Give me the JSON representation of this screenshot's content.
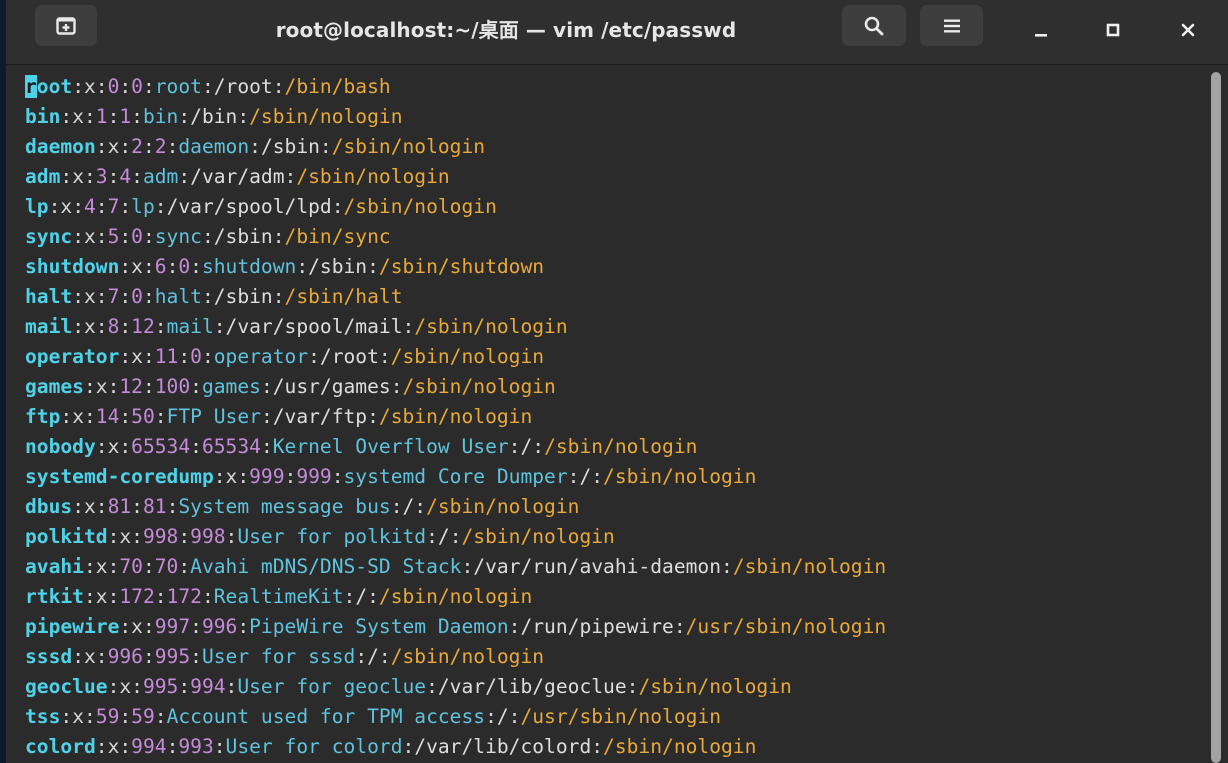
{
  "window": {
    "title": "root@localhost:~/桌面 — vim /etc/passwd",
    "buttons": {
      "new_tab_icon": "new-tab-icon",
      "search_icon": "search-icon",
      "menu_icon": "hamburger-menu-icon",
      "minimize_icon": "minimize-icon",
      "maximize_icon": "maximize-icon",
      "close_icon": "close-icon"
    }
  },
  "colors": {
    "username": "#4fd2e8",
    "ids": "#c58bd9",
    "gecos": "#5fc3de",
    "home": "#dddddd",
    "shell": "#e8a93a",
    "background": "#2b2b2b"
  },
  "terminal": {
    "lines": [
      {
        "user": "root",
        "pw": "x",
        "uid": "0",
        "gid": "0",
        "gecos": "root",
        "home": "/root",
        "shell": "/bin/bash"
      },
      {
        "user": "bin",
        "pw": "x",
        "uid": "1",
        "gid": "1",
        "gecos": "bin",
        "home": "/bin",
        "shell": "/sbin/nologin"
      },
      {
        "user": "daemon",
        "pw": "x",
        "uid": "2",
        "gid": "2",
        "gecos": "daemon",
        "home": "/sbin",
        "shell": "/sbin/nologin"
      },
      {
        "user": "adm",
        "pw": "x",
        "uid": "3",
        "gid": "4",
        "gecos": "adm",
        "home": "/var/adm",
        "shell": "/sbin/nologin"
      },
      {
        "user": "lp",
        "pw": "x",
        "uid": "4",
        "gid": "7",
        "gecos": "lp",
        "home": "/var/spool/lpd",
        "shell": "/sbin/nologin"
      },
      {
        "user": "sync",
        "pw": "x",
        "uid": "5",
        "gid": "0",
        "gecos": "sync",
        "home": "/sbin",
        "shell": "/bin/sync"
      },
      {
        "user": "shutdown",
        "pw": "x",
        "uid": "6",
        "gid": "0",
        "gecos": "shutdown",
        "home": "/sbin",
        "shell": "/sbin/shutdown"
      },
      {
        "user": "halt",
        "pw": "x",
        "uid": "7",
        "gid": "0",
        "gecos": "halt",
        "home": "/sbin",
        "shell": "/sbin/halt"
      },
      {
        "user": "mail",
        "pw": "x",
        "uid": "8",
        "gid": "12",
        "gecos": "mail",
        "home": "/var/spool/mail",
        "shell": "/sbin/nologin"
      },
      {
        "user": "operator",
        "pw": "x",
        "uid": "11",
        "gid": "0",
        "gecos": "operator",
        "home": "/root",
        "shell": "/sbin/nologin"
      },
      {
        "user": "games",
        "pw": "x",
        "uid": "12",
        "gid": "100",
        "gecos": "games",
        "home": "/usr/games",
        "shell": "/sbin/nologin"
      },
      {
        "user": "ftp",
        "pw": "x",
        "uid": "14",
        "gid": "50",
        "gecos": "FTP User",
        "home": "/var/ftp",
        "shell": "/sbin/nologin"
      },
      {
        "user": "nobody",
        "pw": "x",
        "uid": "65534",
        "gid": "65534",
        "gecos": "Kernel Overflow User",
        "home": "/",
        "shell": "/sbin/nologin"
      },
      {
        "user": "systemd-coredump",
        "pw": "x",
        "uid": "999",
        "gid": "999",
        "gecos": "systemd Core Dumper",
        "home": "/",
        "shell": "/sbin/nologin"
      },
      {
        "user": "dbus",
        "pw": "x",
        "uid": "81",
        "gid": "81",
        "gecos": "System message bus",
        "home": "/",
        "shell": "/sbin/nologin"
      },
      {
        "user": "polkitd",
        "pw": "x",
        "uid": "998",
        "gid": "998",
        "gecos": "User for polkitd",
        "home": "/",
        "shell": "/sbin/nologin"
      },
      {
        "user": "avahi",
        "pw": "x",
        "uid": "70",
        "gid": "70",
        "gecos": "Avahi mDNS/DNS-SD Stack",
        "home": "/var/run/avahi-daemon",
        "shell": "/sbin/nologin"
      },
      {
        "user": "rtkit",
        "pw": "x",
        "uid": "172",
        "gid": "172",
        "gecos": "RealtimeKit",
        "home": "/",
        "shell": "/sbin/nologin"
      },
      {
        "user": "pipewire",
        "pw": "x",
        "uid": "997",
        "gid": "996",
        "gecos": "PipeWire System Daemon",
        "home": "/run/pipewire",
        "shell": "/usr/sbin/nologin"
      },
      {
        "user": "sssd",
        "pw": "x",
        "uid": "996",
        "gid": "995",
        "gecos": "User for sssd",
        "home": "/",
        "shell": "/sbin/nologin"
      },
      {
        "user": "geoclue",
        "pw": "x",
        "uid": "995",
        "gid": "994",
        "gecos": "User for geoclue",
        "home": "/var/lib/geoclue",
        "shell": "/sbin/nologin"
      },
      {
        "user": "tss",
        "pw": "x",
        "uid": "59",
        "gid": "59",
        "gecos": "Account used for TPM access",
        "home": "/",
        "shell": "/usr/sbin/nologin"
      },
      {
        "user": "colord",
        "pw": "x",
        "uid": "994",
        "gid": "993",
        "gecos": "User for colord",
        "home": "/var/lib/colord",
        "shell": "/sbin/nologin"
      }
    ]
  }
}
